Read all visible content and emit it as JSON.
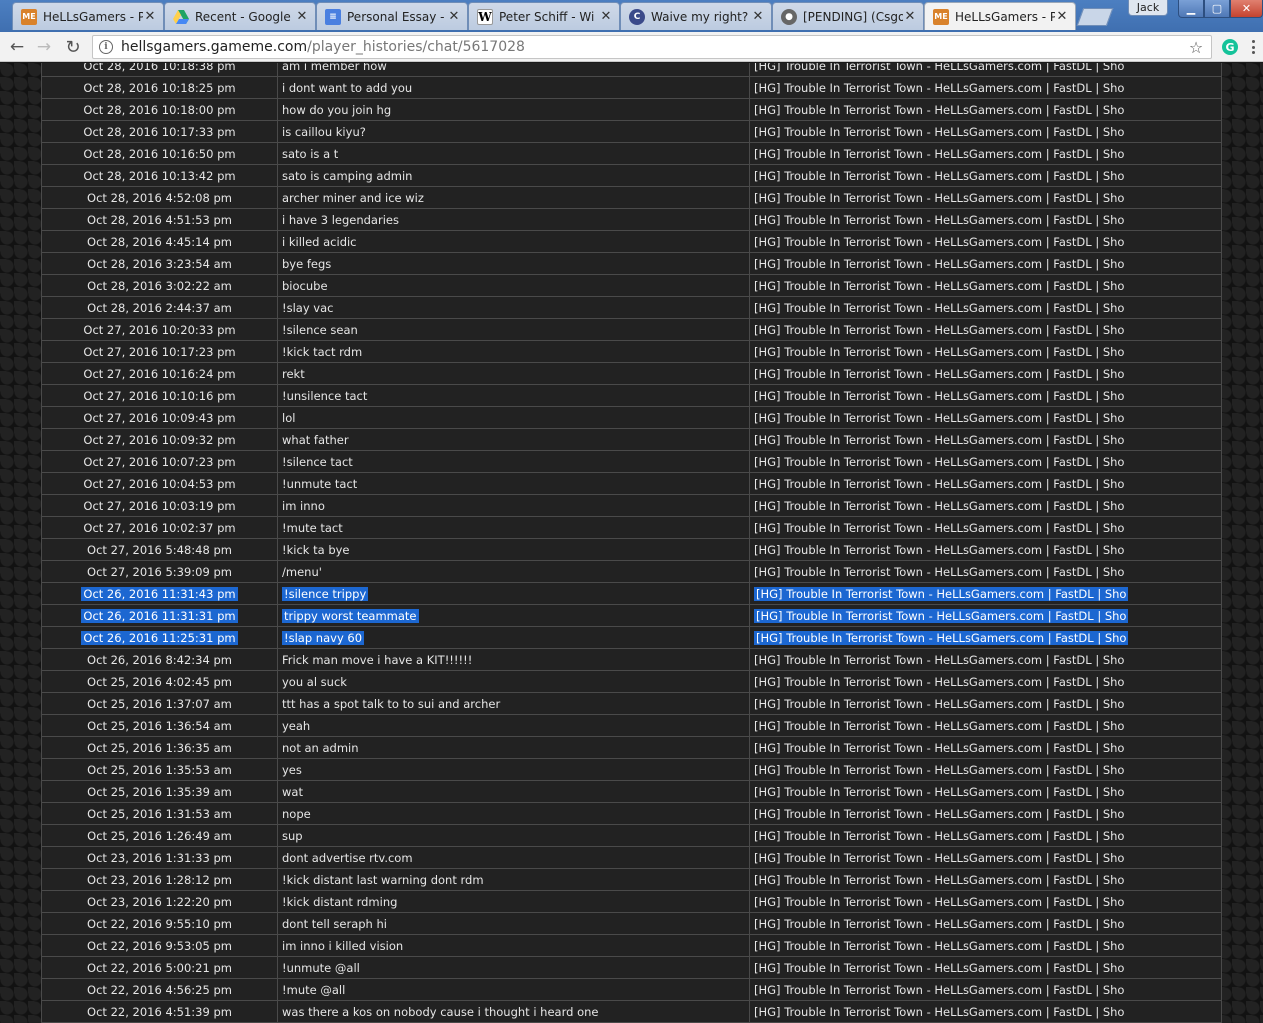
{
  "browser": {
    "tabs": [
      {
        "title": "HeLLsGamers - P",
        "favicon": "hg-icon",
        "active": false
      },
      {
        "title": "Recent - Google",
        "favicon": "google-drive-icon",
        "active": false
      },
      {
        "title": "Personal Essay -",
        "favicon": "google-docs-icon",
        "active": false
      },
      {
        "title": "Peter Schiff - Wi",
        "favicon": "wikipedia-icon",
        "active": false
      },
      {
        "title": "Waive my right?",
        "favicon": "c-icon",
        "active": false
      },
      {
        "title": "[PENDING] (Csgo",
        "favicon": "pending-icon",
        "active": false
      },
      {
        "title": "HeLLsGamers - P",
        "favicon": "hg-icon",
        "active": true
      }
    ],
    "user": "Jack",
    "url_host": "hellsgamers.gameme.com",
    "url_path": "/player_histories/chat/5617028"
  },
  "chat": {
    "rows": [
      {
        "date": "Oct 28, 2016 10:18:38 pm",
        "message": "am i member how",
        "server": "[HG] Trouble In Terrorist Town - HeLLsGamers.com | FastDL | Sho",
        "selected": false
      },
      {
        "date": "Oct 28, 2016 10:18:25 pm",
        "message": "i dont want to add you",
        "server": "[HG] Trouble In Terrorist Town - HeLLsGamers.com | FastDL | Sho",
        "selected": false
      },
      {
        "date": "Oct 28, 2016 10:18:00 pm",
        "message": "how do you join hg",
        "server": "[HG] Trouble In Terrorist Town - HeLLsGamers.com | FastDL | Sho",
        "selected": false
      },
      {
        "date": "Oct 28, 2016 10:17:33 pm",
        "message": "is caillou kiyu?",
        "server": "[HG] Trouble In Terrorist Town - HeLLsGamers.com | FastDL | Sho",
        "selected": false
      },
      {
        "date": "Oct 28, 2016 10:16:50 pm",
        "message": "sato is a t",
        "server": "[HG] Trouble In Terrorist Town - HeLLsGamers.com | FastDL | Sho",
        "selected": false
      },
      {
        "date": "Oct 28, 2016 10:13:42 pm",
        "message": "sato is camping admin",
        "server": "[HG] Trouble In Terrorist Town - HeLLsGamers.com | FastDL | Sho",
        "selected": false
      },
      {
        "date": "Oct 28, 2016 4:52:08 pm",
        "message": "archer miner and ice wiz",
        "server": "[HG] Trouble In Terrorist Town - HeLLsGamers.com | FastDL | Sho",
        "selected": false
      },
      {
        "date": "Oct 28, 2016 4:51:53 pm",
        "message": "i have 3 legendaries",
        "server": "[HG] Trouble In Terrorist Town - HeLLsGamers.com | FastDL | Sho",
        "selected": false
      },
      {
        "date": "Oct 28, 2016 4:45:14 pm",
        "message": "i killed acidic",
        "server": "[HG] Trouble In Terrorist Town - HeLLsGamers.com | FastDL | Sho",
        "selected": false
      },
      {
        "date": "Oct 28, 2016 3:23:54 am",
        "message": "bye fegs",
        "server": "[HG] Trouble In Terrorist Town - HeLLsGamers.com | FastDL | Sho",
        "selected": false
      },
      {
        "date": "Oct 28, 2016 3:02:22 am",
        "message": "biocube",
        "server": "[HG] Trouble In Terrorist Town - HeLLsGamers.com | FastDL | Sho",
        "selected": false
      },
      {
        "date": "Oct 28, 2016 2:44:37 am",
        "message": "!slay vac",
        "server": "[HG] Trouble In Terrorist Town - HeLLsGamers.com | FastDL | Sho",
        "selected": false
      },
      {
        "date": "Oct 27, 2016 10:20:33 pm",
        "message": "!silence sean",
        "server": "[HG] Trouble In Terrorist Town - HeLLsGamers.com | FastDL | Sho",
        "selected": false
      },
      {
        "date": "Oct 27, 2016 10:17:23 pm",
        "message": "!kick tact rdm",
        "server": "[HG] Trouble In Terrorist Town - HeLLsGamers.com | FastDL | Sho",
        "selected": false
      },
      {
        "date": "Oct 27, 2016 10:16:24 pm",
        "message": "rekt",
        "server": "[HG] Trouble In Terrorist Town - HeLLsGamers.com | FastDL | Sho",
        "selected": false
      },
      {
        "date": "Oct 27, 2016 10:10:16 pm",
        "message": "!unsilence tact",
        "server": "[HG] Trouble In Terrorist Town - HeLLsGamers.com | FastDL | Sho",
        "selected": false
      },
      {
        "date": "Oct 27, 2016 10:09:43 pm",
        "message": "lol",
        "server": "[HG] Trouble In Terrorist Town - HeLLsGamers.com | FastDL | Sho",
        "selected": false
      },
      {
        "date": "Oct 27, 2016 10:09:32 pm",
        "message": "what father",
        "server": "[HG] Trouble In Terrorist Town - HeLLsGamers.com | FastDL | Sho",
        "selected": false
      },
      {
        "date": "Oct 27, 2016 10:07:23 pm",
        "message": "!silence tact",
        "server": "[HG] Trouble In Terrorist Town - HeLLsGamers.com | FastDL | Sho",
        "selected": false
      },
      {
        "date": "Oct 27, 2016 10:04:53 pm",
        "message": "!unmute tact",
        "server": "[HG] Trouble In Terrorist Town - HeLLsGamers.com | FastDL | Sho",
        "selected": false
      },
      {
        "date": "Oct 27, 2016 10:03:19 pm",
        "message": "im inno",
        "server": "[HG] Trouble In Terrorist Town - HeLLsGamers.com | FastDL | Sho",
        "selected": false
      },
      {
        "date": "Oct 27, 2016 10:02:37 pm",
        "message": "!mute tact",
        "server": "[HG] Trouble In Terrorist Town - HeLLsGamers.com | FastDL | Sho",
        "selected": false
      },
      {
        "date": "Oct 27, 2016 5:48:48 pm",
        "message": "!kick ta bye",
        "server": "[HG] Trouble In Terrorist Town - HeLLsGamers.com | FastDL | Sho",
        "selected": false
      },
      {
        "date": "Oct 27, 2016 5:39:09 pm",
        "message": "/menu'",
        "server": "[HG] Trouble In Terrorist Town - HeLLsGamers.com | FastDL | Sho",
        "selected": false
      },
      {
        "date": "Oct 26, 2016 11:31:43 pm",
        "message": "!silence trippy",
        "server": "[HG] Trouble In Terrorist Town - HeLLsGamers.com | FastDL | Sho",
        "selected": true
      },
      {
        "date": "Oct 26, 2016 11:31:31 pm",
        "message": "trippy worst teammate",
        "server": "[HG] Trouble In Terrorist Town - HeLLsGamers.com | FastDL | Sho",
        "selected": true
      },
      {
        "date": "Oct 26, 2016 11:25:31 pm",
        "message": "!slap navy 60",
        "server": "[HG] Trouble In Terrorist Town - HeLLsGamers.com | FastDL | Sho",
        "selected": true
      },
      {
        "date": "Oct 26, 2016 8:42:34 pm",
        "message": "Frick man move i have a KIT!!!!!!",
        "server": "[HG] Trouble In Terrorist Town - HeLLsGamers.com | FastDL | Sho",
        "selected": false
      },
      {
        "date": "Oct 25, 2016 4:02:45 pm",
        "message": "you al suck",
        "server": "[HG] Trouble In Terrorist Town - HeLLsGamers.com | FastDL | Sho",
        "selected": false
      },
      {
        "date": "Oct 25, 2016 1:37:07 am",
        "message": "ttt has a spot talk to to sui and archer",
        "server": "[HG] Trouble In Terrorist Town - HeLLsGamers.com | FastDL | Sho",
        "selected": false
      },
      {
        "date": "Oct 25, 2016 1:36:54 am",
        "message": "yeah",
        "server": "[HG] Trouble In Terrorist Town - HeLLsGamers.com | FastDL | Sho",
        "selected": false
      },
      {
        "date": "Oct 25, 2016 1:36:35 am",
        "message": "not an admin",
        "server": "[HG] Trouble In Terrorist Town - HeLLsGamers.com | FastDL | Sho",
        "selected": false
      },
      {
        "date": "Oct 25, 2016 1:35:53 am",
        "message": "yes",
        "server": "[HG] Trouble In Terrorist Town - HeLLsGamers.com | FastDL | Sho",
        "selected": false
      },
      {
        "date": "Oct 25, 2016 1:35:39 am",
        "message": "wat",
        "server": "[HG] Trouble In Terrorist Town - HeLLsGamers.com | FastDL | Sho",
        "selected": false
      },
      {
        "date": "Oct 25, 2016 1:31:53 am",
        "message": "nope",
        "server": "[HG] Trouble In Terrorist Town - HeLLsGamers.com | FastDL | Sho",
        "selected": false
      },
      {
        "date": "Oct 25, 2016 1:26:49 am",
        "message": "sup",
        "server": "[HG] Trouble In Terrorist Town - HeLLsGamers.com | FastDL | Sho",
        "selected": false
      },
      {
        "date": "Oct 23, 2016 1:31:33 pm",
        "message": "dont advertise rtv.com",
        "server": "[HG] Trouble In Terrorist Town - HeLLsGamers.com | FastDL | Sho",
        "selected": false
      },
      {
        "date": "Oct 23, 2016 1:28:12 pm",
        "message": "!kick distant last warning dont rdm",
        "server": "[HG] Trouble In Terrorist Town - HeLLsGamers.com | FastDL | Sho",
        "selected": false
      },
      {
        "date": "Oct 23, 2016 1:22:20 pm",
        "message": "!kick distant rdming",
        "server": "[HG] Trouble In Terrorist Town - HeLLsGamers.com | FastDL | Sho",
        "selected": false
      },
      {
        "date": "Oct 22, 2016 9:55:10 pm",
        "message": "dont tell seraph hi",
        "server": "[HG] Trouble In Terrorist Town - HeLLsGamers.com | FastDL | Sho",
        "selected": false
      },
      {
        "date": "Oct 22, 2016 9:53:05 pm",
        "message": "im inno i killed vision",
        "server": "[HG] Trouble In Terrorist Town - HeLLsGamers.com | FastDL | Sho",
        "selected": false
      },
      {
        "date": "Oct 22, 2016 5:00:21 pm",
        "message": "!unmute @all",
        "server": "[HG] Trouble In Terrorist Town - HeLLsGamers.com | FastDL | Sho",
        "selected": false
      },
      {
        "date": "Oct 22, 2016 4:56:25 pm",
        "message": "!mute @all",
        "server": "[HG] Trouble In Terrorist Town - HeLLsGamers.com | FastDL | Sho",
        "selected": false
      },
      {
        "date": "Oct 22, 2016 4:51:39 pm",
        "message": "was there a kos on nobody cause i thought i heard one",
        "server": "[HG] Trouble In Terrorist Town - HeLLsGamers.com | FastDL | Sho",
        "selected": false
      }
    ]
  },
  "colors": {
    "selection": "#1c67d1",
    "table_bg": "#222222",
    "grid": "#4a4a4a",
    "text": "#e6e6e6"
  }
}
